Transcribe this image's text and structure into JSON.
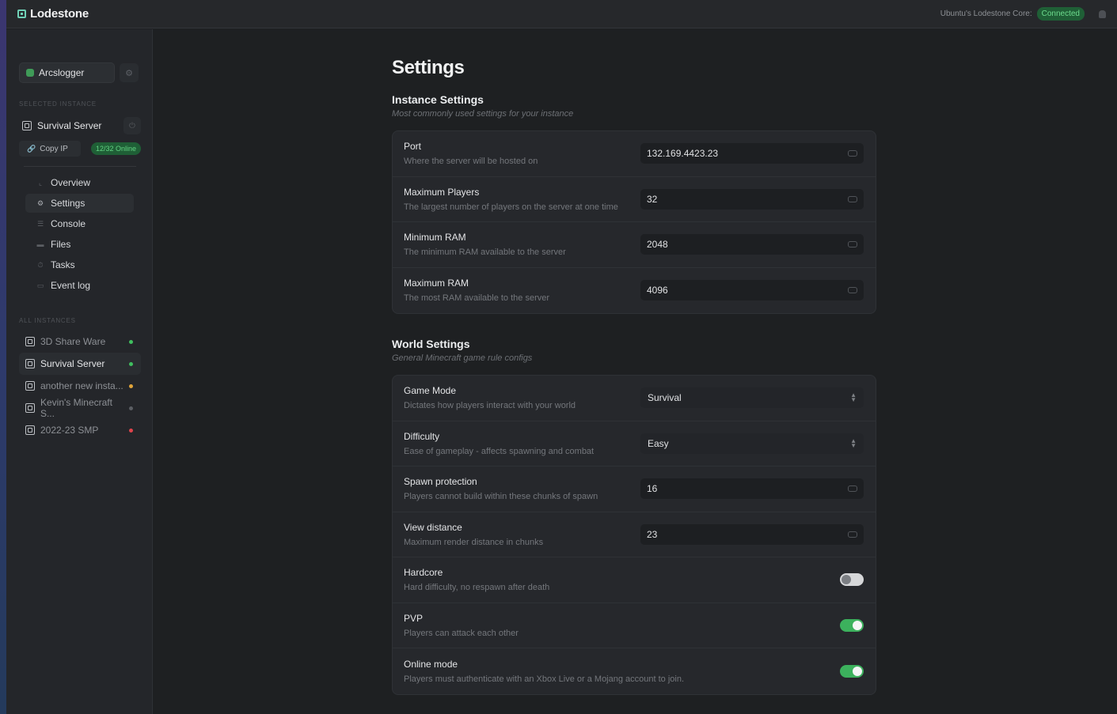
{
  "app": {
    "name": "Lodestone",
    "core_label": "Ubuntu's Lodestone Core:",
    "core_status": "Connected"
  },
  "sidebar": {
    "user": "Arcslogger",
    "selected_label": "SELECTED INSTANCE",
    "selected_instance": "Survival Server",
    "copy_ip": "Copy IP",
    "online": "12/32 Online",
    "nav": [
      {
        "label": "Overview",
        "icon": "chart-icon"
      },
      {
        "label": "Settings",
        "icon": "gear-icon"
      },
      {
        "label": "Console",
        "icon": "console-icon"
      },
      {
        "label": "Files",
        "icon": "folder-icon"
      },
      {
        "label": "Tasks",
        "icon": "tasks-icon"
      },
      {
        "label": "Event log",
        "icon": "log-icon"
      }
    ],
    "all_label": "ALL INSTANCES",
    "instances": [
      {
        "name": "3D Share Ware",
        "status_color": "#3fbf5f"
      },
      {
        "name": "Survival Server",
        "status_color": "#3fbf5f"
      },
      {
        "name": "another new insta...",
        "status_color": "#e0a43a"
      },
      {
        "name": "Kevin's Minecraft S...",
        "status_color": "#5b5e63"
      },
      {
        "name": "2022-23 SMP",
        "status_color": "#e0444c"
      }
    ]
  },
  "main": {
    "title": "Settings",
    "instance_section": {
      "title": "Instance Settings",
      "subtitle": "Most commonly used settings for your instance",
      "rows": [
        {
          "label": "Port",
          "desc": "Where the server will be hosted on",
          "value": "132.169.4423.23"
        },
        {
          "label": "Maximum Players",
          "desc": "The largest number of players on the server at one time",
          "value": "32"
        },
        {
          "label": "Minimum RAM",
          "desc": "The minimum RAM available to the server",
          "value": "2048"
        },
        {
          "label": "Maximum RAM",
          "desc": "The most RAM available to the server",
          "value": "4096"
        }
      ]
    },
    "world_section": {
      "title": "World Settings",
      "subtitle": "General Minecraft game rule configs",
      "game_mode": {
        "label": "Game Mode",
        "desc": "Dictates how players interact with your world",
        "value": "Survival"
      },
      "difficulty": {
        "label": "Difficulty",
        "desc": "Ease of gameplay - affects spawning and combat",
        "value": "Easy"
      },
      "spawn_protection": {
        "label": "Spawn protection",
        "desc": "Players cannot build within these chunks of spawn",
        "value": "16"
      },
      "view_distance": {
        "label": "View distance",
        "desc": "Maximum render distance in chunks",
        "value": "23"
      },
      "hardcore": {
        "label": "Hardcore",
        "desc": "Hard difficulty, no respawn after death",
        "on": false
      },
      "pvp": {
        "label": "PVP",
        "desc": "Players can attack each other",
        "on": true
      },
      "online_mode": {
        "label": "Online mode",
        "desc": "Players must authenticate with an Xbox Live or a Mojang account to join.",
        "on": true
      }
    }
  }
}
